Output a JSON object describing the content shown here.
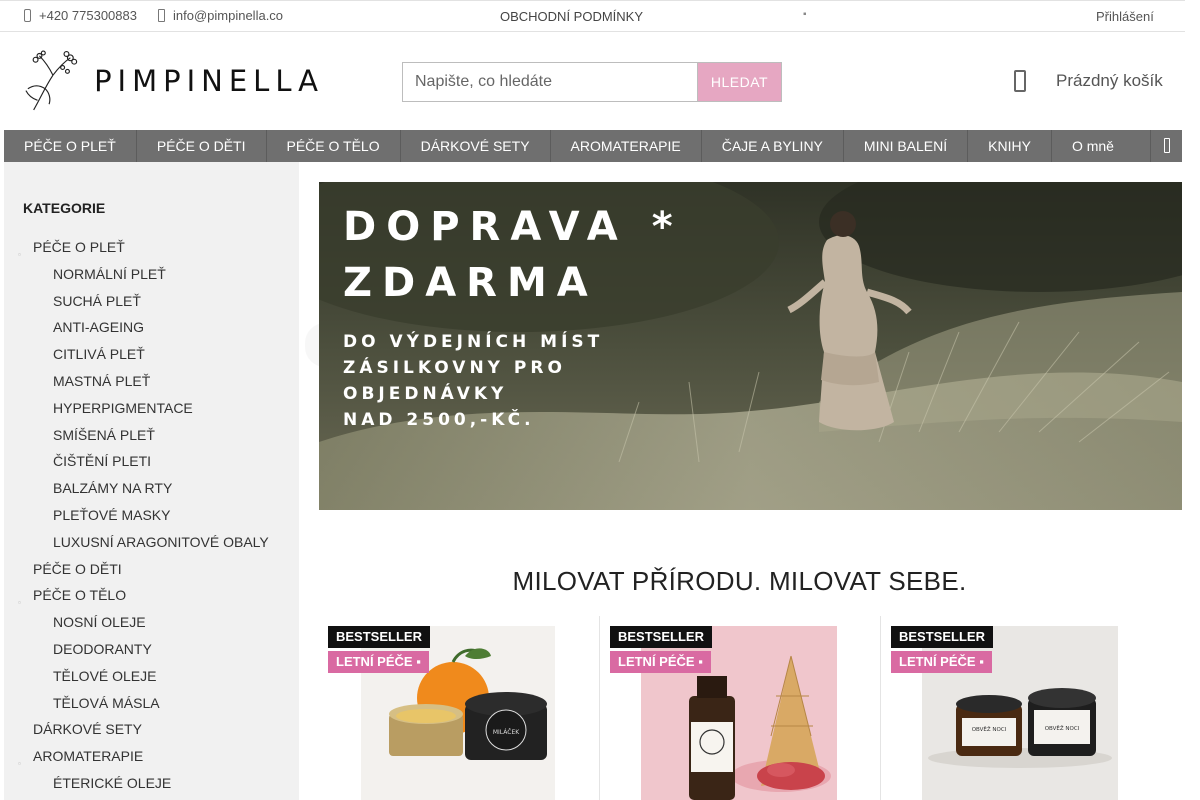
{
  "topbar": {
    "phone": "+420 775300883",
    "email": "info@pimpinella.co",
    "terms": "OBCHODNÍ PODMÍNKY",
    "login": "Přihlášení"
  },
  "header": {
    "logo_text": "PIMPINELLA",
    "search_placeholder": "Napište, co hledáte",
    "search_button": "HLEDAT",
    "cart_label": "Prázdný košík"
  },
  "nav": {
    "items": [
      "PÉČE O PLEŤ",
      "PÉČE O DĚTI",
      "PÉČE O TĚLO",
      "DÁRKOVÉ SETY",
      "AROMATERAPIE",
      "ČAJE A BYLINY",
      "MINI BALENÍ",
      "KNIHY",
      "O mně"
    ]
  },
  "sidebar": {
    "title": "KATEGORIE",
    "items": [
      {
        "label": "PÉČE O PLEŤ",
        "level": 1
      },
      {
        "label": "NORMÁLNÍ PLEŤ",
        "level": 2
      },
      {
        "label": "SUCHÁ PLEŤ",
        "level": 2
      },
      {
        "label": "ANTI-AGEING",
        "level": 2
      },
      {
        "label": "CITLIVÁ PLEŤ",
        "level": 2
      },
      {
        "label": "MASTNÁ PLEŤ",
        "level": 2
      },
      {
        "label": "HYPERPIGMENTACE",
        "level": 2
      },
      {
        "label": "SMÍŠENÁ PLEŤ",
        "level": 2
      },
      {
        "label": "ČIŠTĚNÍ PLETI",
        "level": 2
      },
      {
        "label": "BALZÁMY NA RTY",
        "level": 2
      },
      {
        "label": "PLEŤOVÉ MASKY",
        "level": 2
      },
      {
        "label": "LUXUSNÍ ARAGONITOVÉ OBALY",
        "level": 2
      },
      {
        "label": "PÉČE O DĚTI",
        "level": 1
      },
      {
        "label": "PÉČE O TĚLO",
        "level": 1
      },
      {
        "label": "NOSNÍ OLEJE",
        "level": 2
      },
      {
        "label": "DEODORANTY",
        "level": 2
      },
      {
        "label": "TĚLOVÉ OLEJE",
        "level": 2
      },
      {
        "label": "TĚLOVÁ MÁSLA",
        "level": 2
      },
      {
        "label": "DÁRKOVÉ SETY",
        "level": 1
      },
      {
        "label": "AROMATERAPIE",
        "level": 1
      },
      {
        "label": "ÉTERICKÉ OLEJE",
        "level": 2
      }
    ]
  },
  "banner": {
    "line1": "DOPRAVA *",
    "line2": "ZDARMA",
    "line3": "DO VÝDEJNÍCH MÍST",
    "line4": "ZÁSILKOVNY PRO",
    "line5": "OBJEDNÁVKY",
    "line6": "NAD 2500,-KČ."
  },
  "headline": "MILOVAT PŘÍRODU. MILOVAT SEBE.",
  "products": [
    {
      "badge1": "BESTSELLER",
      "badge2": "LETNÍ PÉČE",
      "jar_label": "MILÁČEK"
    },
    {
      "badge1": "BESTSELLER",
      "badge2": "LETNÍ PÉČE"
    },
    {
      "badge1": "BESTSELLER",
      "badge2": "LETNÍ PÉČE",
      "jar_label_a": "OBVĚŽ NOCI",
      "jar_label_b": "OBVĚŽ NOCI"
    }
  ],
  "colors": {
    "nav_bg": "#6f6f6f",
    "search_button_bg": "#e6a7c2",
    "badge_summer": "#d96aa2",
    "sidebar_bg": "#f1f1f1"
  }
}
